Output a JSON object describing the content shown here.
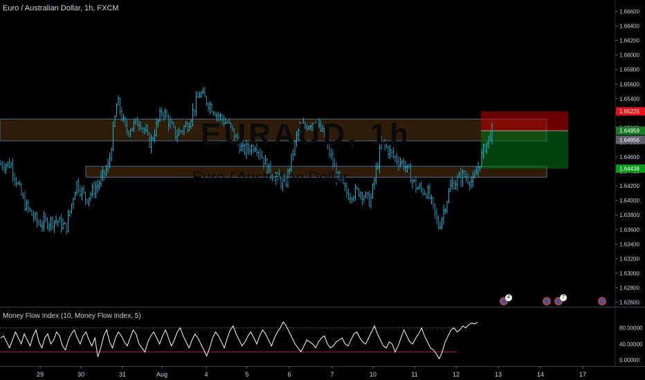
{
  "header": {
    "title": "Euro / Australian Dollar, 1h, FXCM",
    "watermark_symbol": "EURAUD, 1h",
    "watermark_name": "Euro / Australian Dollar"
  },
  "indicator": {
    "title": "Money Flow Index (10, Money Flow Index, 5)",
    "levels": [
      80,
      20
    ]
  },
  "price_tags": [
    {
      "label": "1.65225",
      "color": "#e8111a"
    },
    {
      "label": "1.64959",
      "color": "#1a7a27"
    },
    {
      "label": "45:49",
      "color": "#1a7a27"
    },
    {
      "label": "1.64956",
      "color": "#5d606b"
    },
    {
      "label": "1.64438",
      "color": "#0c9a1c"
    }
  ],
  "events": [
    {
      "badge": "4"
    },
    {
      "badge": ""
    },
    {
      "badge": "7"
    },
    {
      "badge": ""
    }
  ],
  "chart_data": [
    {
      "type": "ohlc",
      "title": "Euro / Australian Dollar, 1h, FXCM",
      "ylim": [
        1.6255,
        1.6676
      ],
      "y_ticks": [
        "1.66600",
        "1.66400",
        "1.66200",
        "1.66000",
        "1.65800",
        "1.65600",
        "1.65400",
        "1.65200",
        "1.65000",
        "1.64800",
        "1.64600",
        "1.64400",
        "1.64200",
        "1.64000",
        "1.63800",
        "1.63600",
        "1.63400",
        "1.63200",
        "1.63000",
        "1.62800",
        "1.62600"
      ],
      "x_ticks": [
        "29",
        "30",
        "31",
        "Aug",
        "4",
        "5",
        "6",
        "7",
        "10",
        "11",
        "12",
        "13",
        "14",
        "17"
      ],
      "series": [
        {
          "price_path": [
            {
              "x": "28 07:00",
              "y": 1.645
            },
            {
              "x": "28 15:00",
              "y": 1.6395
            },
            {
              "x": "28 23:00",
              "y": 1.6368
            },
            {
              "x": "29 09:00",
              "y": 1.6373
            },
            {
              "x": "29 15:00",
              "y": 1.6362
            },
            {
              "x": "29 21:00",
              "y": 1.6425
            },
            {
              "x": "30 03:00",
              "y": 1.6402
            },
            {
              "x": "30 10:00",
              "y": 1.6422
            },
            {
              "x": "30 16:00",
              "y": 1.6448
            },
            {
              "x": "30 21:00",
              "y": 1.6538
            },
            {
              "x": "31 02:00",
              "y": 1.6495
            },
            {
              "x": "31 10:00",
              "y": 1.651
            },
            {
              "x": "31 16:00",
              "y": 1.6478
            },
            {
              "x": "31 23:00",
              "y": 1.6525
            },
            {
              "x": "Aug 03 08:00",
              "y": 1.649
            },
            {
              "x": "Aug 03 15:00",
              "y": 1.6505
            },
            {
              "x": "Aug 03 22:00",
              "y": 1.6548
            },
            {
              "x": "4 06:00",
              "y": 1.652
            },
            {
              "x": "4 14:00",
              "y": 1.65
            },
            {
              "x": "4 21:00",
              "y": 1.6468
            },
            {
              "x": "5 05:00",
              "y": 1.6477
            },
            {
              "x": "5 13:00",
              "y": 1.644
            },
            {
              "x": "5 22:00",
              "y": 1.642
            },
            {
              "x": "6 05:00",
              "y": 1.6495
            },
            {
              "x": "6 14:00",
              "y": 1.651
            },
            {
              "x": "6 20:00",
              "y": 1.649
            },
            {
              "x": "7 03:00",
              "y": 1.6432
            },
            {
              "x": "7 09:00",
              "y": 1.6408
            },
            {
              "x": "7 16:00",
              "y": 1.6413
            },
            {
              "x": "7 22:00",
              "y": 1.6398
            },
            {
              "x": "10 05:00",
              "y": 1.648
            },
            {
              "x": "10 12:00",
              "y": 1.646
            },
            {
              "x": "10 18:00",
              "y": 1.645
            },
            {
              "x": "11 01:00",
              "y": 1.6418
            },
            {
              "x": "11 08:00",
              "y": 1.641
            },
            {
              "x": "11 14:00",
              "y": 1.6363
            },
            {
              "x": "11 21:00",
              "y": 1.642
            },
            {
              "x": "12 04:00",
              "y": 1.6435
            },
            {
              "x": "12 10:00",
              "y": 1.6425
            },
            {
              "x": "12 16:00",
              "y": 1.647
            },
            {
              "x": "12 21:00",
              "y": 1.6497
            }
          ]
        }
      ],
      "zones": [
        {
          "name": "resistance-zone",
          "y_top": 1.6512,
          "y_bottom": 1.6482,
          "x_start": "before 29",
          "x_end": "14"
        },
        {
          "name": "support-zone",
          "y_top": 1.6447,
          "y_bottom": 1.6432,
          "x_start": "30",
          "x_end": "14"
        }
      ],
      "position": {
        "type": "short",
        "entry": 1.64959,
        "stop": 1.65225,
        "target": 1.64438,
        "x_start": "12",
        "x_end": "14"
      },
      "current_price": 1.64956
    },
    {
      "type": "line",
      "title": "Money Flow Index (10, Money Flow Index, 5)",
      "ylim": [
        -5,
        105
      ],
      "y_ticks": [
        "80.00000",
        "40.00000",
        "0.00000"
      ],
      "levels": [
        80,
        20
      ],
      "series": [
        {
          "values": [
            55,
            60,
            45,
            30,
            50,
            70,
            55,
            40,
            65,
            50,
            35,
            60,
            75,
            45,
            30,
            55,
            65,
            40,
            50,
            70,
            60,
            35,
            25,
            50,
            65,
            75,
            55,
            40,
            60,
            70,
            50,
            35,
            55,
            8,
            30,
            60,
            75,
            45,
            30,
            55,
            70,
            60,
            45,
            35,
            55,
            75,
            65,
            40,
            30,
            20,
            45,
            60,
            70,
            55,
            40,
            60,
            75,
            55,
            35,
            50,
            70,
            80,
            60,
            45,
            30,
            50,
            65,
            55,
            40,
            25,
            10,
            30,
            55,
            70,
            60,
            45,
            30,
            55,
            75,
            85,
            65,
            50,
            35,
            45,
            60,
            70,
            55,
            40,
            60,
            75,
            65,
            50,
            35,
            55,
            70,
            80,
            95,
            85,
            70,
            55,
            40,
            30,
            20,
            35,
            50,
            45,
            40,
            30,
            45,
            55,
            60,
            40,
            30,
            35,
            45,
            50,
            55,
            40,
            35,
            50,
            65,
            70,
            55,
            45,
            40,
            55,
            70,
            85,
            65,
            50,
            35,
            30,
            45,
            40,
            20,
            35,
            55,
            75,
            60,
            45,
            40,
            55,
            65,
            80,
            60,
            45,
            30,
            25,
            15,
            3,
            20,
            45,
            60,
            75,
            80,
            70,
            75,
            85,
            80,
            88,
            92,
            90,
            94
          ]
        }
      ]
    }
  ]
}
